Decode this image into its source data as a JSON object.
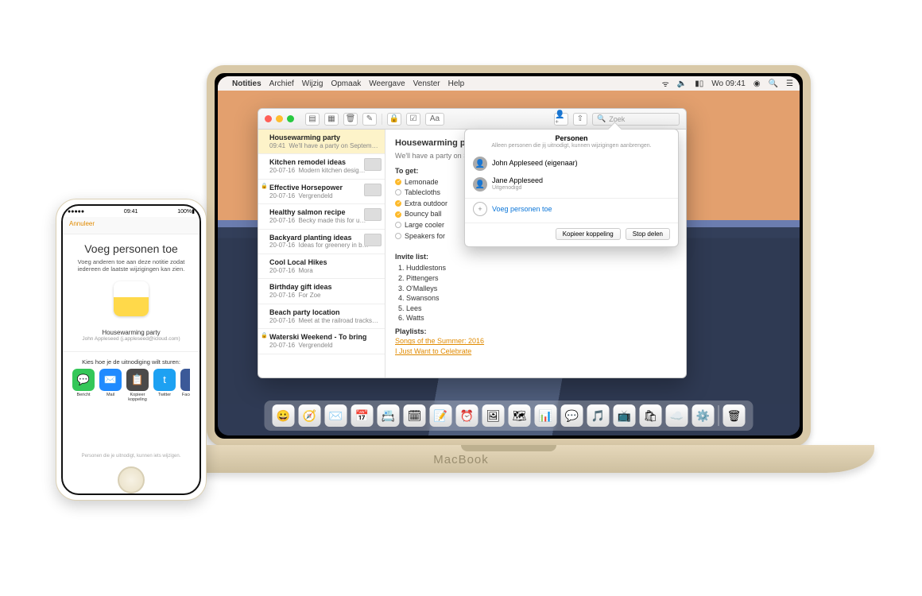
{
  "macos": {
    "menubar": {
      "apple": "",
      "app": "Notities",
      "items": [
        "Archief",
        "Wijzig",
        "Opmaak",
        "Weergave",
        "Venster",
        "Help"
      ],
      "clock": "Wo 09:41"
    },
    "toolbar": {
      "search_placeholder": "Zoek"
    },
    "notes": [
      {
        "title": "Housewarming party",
        "date": "09:41",
        "preview": "We'll have a party on September",
        "selected": true,
        "thumb": false
      },
      {
        "title": "Kitchen remodel ideas",
        "date": "20-07-16",
        "preview": "Modern kitchen desig…",
        "thumb": true
      },
      {
        "title": "Effective Horsepower",
        "date": "20-07-16",
        "preview": "Vergrendeld",
        "locked": true,
        "thumb": true
      },
      {
        "title": "Healthy salmon recipe",
        "date": "20-07-16",
        "preview": "Becky made this for u…",
        "thumb": true
      },
      {
        "title": "Backyard planting ideas",
        "date": "20-07-16",
        "preview": "Ideas for greenery in b…",
        "thumb": true
      },
      {
        "title": "Cool Local Hikes",
        "date": "20-07-16",
        "preview": "Mora"
      },
      {
        "title": "Birthday gift ideas",
        "date": "20-07-16",
        "preview": "For Zoe"
      },
      {
        "title": "Beach party location",
        "date": "20-07-16",
        "preview": "Meet at the railroad tracks…"
      },
      {
        "title": "Waterski Weekend - To bring",
        "date": "20-07-16",
        "preview": "Vergrendeld",
        "locked": true
      }
    ],
    "content": {
      "title": "Housewarming party",
      "subtitle": "We'll have a party on September",
      "to_get_label": "To get:",
      "to_get": [
        {
          "text": "Lemonade",
          "done": true
        },
        {
          "text": "Tablecloths",
          "done": false
        },
        {
          "text": "Extra outdoor",
          "done": true
        },
        {
          "text": "Bouncy ball",
          "done": true
        },
        {
          "text": "Large cooler",
          "done": false
        },
        {
          "text": "Speakers for",
          "done": false
        }
      ],
      "invite_label": "Invite list:",
      "invites": [
        "Huddlestons",
        "Pittengers",
        "O'Malleys",
        "Swansons",
        "Lees",
        "Watts"
      ],
      "playlists_label": "Playlists:",
      "playlists": [
        "Songs of the Summer: 2016",
        "I Just Want to Celebrate"
      ]
    },
    "popover": {
      "title": "Personen",
      "subtitle": "Alleen personen die jij uitnodigt, kunnen wijzigingen aanbrengen.",
      "people": [
        {
          "name": "John Appleseed (eigenaar)",
          "status": ""
        },
        {
          "name": "Jane Appleseed",
          "status": "Uitgenodigd"
        }
      ],
      "add_label": "Voeg personen toe",
      "copy_btn": "Kopieer koppeling",
      "stop_btn": "Stop delen"
    },
    "dock": [
      "😀",
      "🧭",
      "✉️",
      "📅",
      "📇",
      "🗓",
      "📝",
      "⏰",
      "🖼",
      "🗺",
      "📊",
      "💬",
      "🎵",
      "📺",
      "🛍",
      "☁️",
      "⚙️",
      " ",
      "🗑"
    ]
  },
  "iphone": {
    "status": {
      "carrier": "●●●●●",
      "time": "09:41",
      "battery": "100%▮"
    },
    "cancel": "Annuleer",
    "title": "Voeg personen toe",
    "desc": "Voeg anderen toe aan deze notitie zodat iedereen de laatste wijzigingen kan zien.",
    "note_title": "Housewarming party",
    "note_sub": "John Appleseed (j.appleseed@icloud.com)",
    "choose": "Kies hoe je de uitnodiging wilt sturen:",
    "share": [
      {
        "label": "Bericht",
        "color": "#34c759",
        "glyph": "💬"
      },
      {
        "label": "Mail",
        "color": "#1f8bff",
        "glyph": "✉️"
      },
      {
        "label": "Kopieer koppeling",
        "color": "#4a4a4a",
        "glyph": "📋"
      },
      {
        "label": "Twitter",
        "color": "#1da1f2",
        "glyph": "t"
      },
      {
        "label": "Facebook",
        "color": "#3b5998",
        "glyph": "f"
      }
    ],
    "footer": "Personen die je uitnodigt, kunnen iets wijzigen."
  }
}
